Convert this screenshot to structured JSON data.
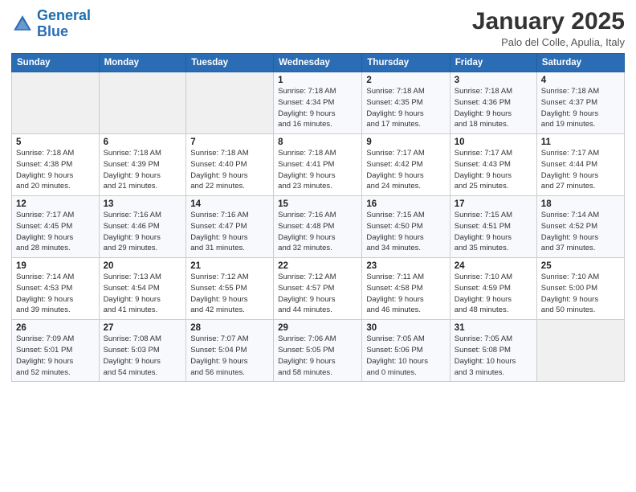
{
  "header": {
    "logo_line1": "General",
    "logo_line2": "Blue",
    "title": "January 2025",
    "subtitle": "Palo del Colle, Apulia, Italy"
  },
  "weekdays": [
    "Sunday",
    "Monday",
    "Tuesday",
    "Wednesday",
    "Thursday",
    "Friday",
    "Saturday"
  ],
  "weeks": [
    [
      {
        "day": "",
        "info": ""
      },
      {
        "day": "",
        "info": ""
      },
      {
        "day": "",
        "info": ""
      },
      {
        "day": "1",
        "info": "Sunrise: 7:18 AM\nSunset: 4:34 PM\nDaylight: 9 hours\nand 16 minutes."
      },
      {
        "day": "2",
        "info": "Sunrise: 7:18 AM\nSunset: 4:35 PM\nDaylight: 9 hours\nand 17 minutes."
      },
      {
        "day": "3",
        "info": "Sunrise: 7:18 AM\nSunset: 4:36 PM\nDaylight: 9 hours\nand 18 minutes."
      },
      {
        "day": "4",
        "info": "Sunrise: 7:18 AM\nSunset: 4:37 PM\nDaylight: 9 hours\nand 19 minutes."
      }
    ],
    [
      {
        "day": "5",
        "info": "Sunrise: 7:18 AM\nSunset: 4:38 PM\nDaylight: 9 hours\nand 20 minutes."
      },
      {
        "day": "6",
        "info": "Sunrise: 7:18 AM\nSunset: 4:39 PM\nDaylight: 9 hours\nand 21 minutes."
      },
      {
        "day": "7",
        "info": "Sunrise: 7:18 AM\nSunset: 4:40 PM\nDaylight: 9 hours\nand 22 minutes."
      },
      {
        "day": "8",
        "info": "Sunrise: 7:18 AM\nSunset: 4:41 PM\nDaylight: 9 hours\nand 23 minutes."
      },
      {
        "day": "9",
        "info": "Sunrise: 7:17 AM\nSunset: 4:42 PM\nDaylight: 9 hours\nand 24 minutes."
      },
      {
        "day": "10",
        "info": "Sunrise: 7:17 AM\nSunset: 4:43 PM\nDaylight: 9 hours\nand 25 minutes."
      },
      {
        "day": "11",
        "info": "Sunrise: 7:17 AM\nSunset: 4:44 PM\nDaylight: 9 hours\nand 27 minutes."
      }
    ],
    [
      {
        "day": "12",
        "info": "Sunrise: 7:17 AM\nSunset: 4:45 PM\nDaylight: 9 hours\nand 28 minutes."
      },
      {
        "day": "13",
        "info": "Sunrise: 7:16 AM\nSunset: 4:46 PM\nDaylight: 9 hours\nand 29 minutes."
      },
      {
        "day": "14",
        "info": "Sunrise: 7:16 AM\nSunset: 4:47 PM\nDaylight: 9 hours\nand 31 minutes."
      },
      {
        "day": "15",
        "info": "Sunrise: 7:16 AM\nSunset: 4:48 PM\nDaylight: 9 hours\nand 32 minutes."
      },
      {
        "day": "16",
        "info": "Sunrise: 7:15 AM\nSunset: 4:50 PM\nDaylight: 9 hours\nand 34 minutes."
      },
      {
        "day": "17",
        "info": "Sunrise: 7:15 AM\nSunset: 4:51 PM\nDaylight: 9 hours\nand 35 minutes."
      },
      {
        "day": "18",
        "info": "Sunrise: 7:14 AM\nSunset: 4:52 PM\nDaylight: 9 hours\nand 37 minutes."
      }
    ],
    [
      {
        "day": "19",
        "info": "Sunrise: 7:14 AM\nSunset: 4:53 PM\nDaylight: 9 hours\nand 39 minutes."
      },
      {
        "day": "20",
        "info": "Sunrise: 7:13 AM\nSunset: 4:54 PM\nDaylight: 9 hours\nand 41 minutes."
      },
      {
        "day": "21",
        "info": "Sunrise: 7:12 AM\nSunset: 4:55 PM\nDaylight: 9 hours\nand 42 minutes."
      },
      {
        "day": "22",
        "info": "Sunrise: 7:12 AM\nSunset: 4:57 PM\nDaylight: 9 hours\nand 44 minutes."
      },
      {
        "day": "23",
        "info": "Sunrise: 7:11 AM\nSunset: 4:58 PM\nDaylight: 9 hours\nand 46 minutes."
      },
      {
        "day": "24",
        "info": "Sunrise: 7:10 AM\nSunset: 4:59 PM\nDaylight: 9 hours\nand 48 minutes."
      },
      {
        "day": "25",
        "info": "Sunrise: 7:10 AM\nSunset: 5:00 PM\nDaylight: 9 hours\nand 50 minutes."
      }
    ],
    [
      {
        "day": "26",
        "info": "Sunrise: 7:09 AM\nSunset: 5:01 PM\nDaylight: 9 hours\nand 52 minutes."
      },
      {
        "day": "27",
        "info": "Sunrise: 7:08 AM\nSunset: 5:03 PM\nDaylight: 9 hours\nand 54 minutes."
      },
      {
        "day": "28",
        "info": "Sunrise: 7:07 AM\nSunset: 5:04 PM\nDaylight: 9 hours\nand 56 minutes."
      },
      {
        "day": "29",
        "info": "Sunrise: 7:06 AM\nSunset: 5:05 PM\nDaylight: 9 hours\nand 58 minutes."
      },
      {
        "day": "30",
        "info": "Sunrise: 7:05 AM\nSunset: 5:06 PM\nDaylight: 10 hours\nand 0 minutes."
      },
      {
        "day": "31",
        "info": "Sunrise: 7:05 AM\nSunset: 5:08 PM\nDaylight: 10 hours\nand 3 minutes."
      },
      {
        "day": "",
        "info": ""
      }
    ]
  ]
}
